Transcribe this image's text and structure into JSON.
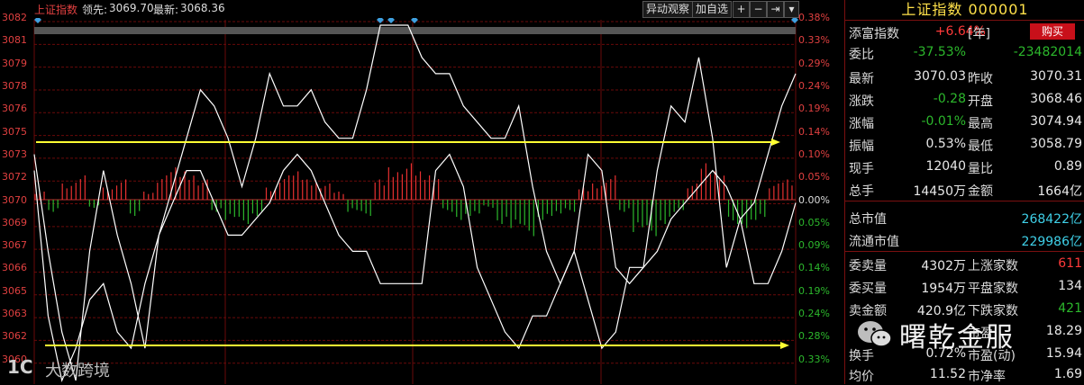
{
  "toolbar": {
    "index_name": "上证指数",
    "lead_label": "领先:",
    "lead_value": "3069.70",
    "latest_label": "最新:",
    "latest_value": "3068.36",
    "btn_watch": "异动观察",
    "btn_add": "加自选",
    "btn_plus": "+",
    "btn_minus": "−",
    "btn_end": "⇥",
    "btn_menu": "▾"
  },
  "axis_left": [
    "3082",
    "3081",
    "3079",
    "3078",
    "3076",
    "3075",
    "3073",
    "3072",
    "3070",
    "3069",
    "3067",
    "3066",
    "3065",
    "3063",
    "3062",
    "3060"
  ],
  "axis_right": [
    "0.38%",
    "0.33%",
    "0.29%",
    "0.24%",
    "0.19%",
    "0.14%",
    "0.10%",
    "0.05%",
    "0.00%",
    "0.05%",
    "0.09%",
    "0.14%",
    "0.19%",
    "0.24%",
    "0.28%",
    "0.33%"
  ],
  "colors": {
    "up": "#e83030",
    "down": "#2cb82c",
    "price_line": "#ffffff",
    "arrow": "#ffff33",
    "grid": "#6a0a0a",
    "title": "#ffe14a",
    "cyan": "#3fd0e8"
  },
  "watermark": {
    "left_text": "大数跨境",
    "right_text": "曙乾金服"
  },
  "panel": {
    "title": "上证指数 000001",
    "buy_label": "购买",
    "rows": [
      {
        "l1": "添富指数",
        "v1": "+6.64%",
        "l2": "[年]",
        "v2": ""
      },
      {
        "l1": "委比",
        "v1": "-37.53%",
        "l2": "",
        "v2": "-23482014"
      },
      {
        "l1": "最新",
        "v1": "3070.03",
        "l2": "昨收",
        "v2": "3070.31"
      },
      {
        "l1": "涨跌",
        "v1": "-0.28",
        "l2": "开盘",
        "v2": "3068.46"
      },
      {
        "l1": "涨幅",
        "v1": "-0.01%",
        "l2": "最高",
        "v2": "3074.94"
      },
      {
        "l1": "振幅",
        "v1": "0.53%",
        "l2": "最低",
        "v2": "3058.79"
      },
      {
        "l1": "现手",
        "v1": "12040",
        "l2": "量比",
        "v2": "0.89"
      },
      {
        "l1": "总手",
        "v1": "14450万",
        "l2": "金额",
        "v2": "1664亿"
      },
      {
        "l1": "总市值",
        "v1": "",
        "l2": "",
        "v2": "268422亿"
      },
      {
        "l1": "流通市值",
        "v1": "",
        "l2": "",
        "v2": "229986亿"
      },
      {
        "l1": "委卖量",
        "v1": "4302万",
        "l2": "上涨家数",
        "v2": "611"
      },
      {
        "l1": "委买量",
        "v1": "1954万",
        "l2": "平盘家数",
        "v2": "134"
      },
      {
        "l1": "卖金额",
        "v1": "420.9亿",
        "l2": "下跌家数",
        "v2": "421"
      },
      {
        "l1": "",
        "v1": "",
        "l2": "市盈",
        "v2": "18.29"
      },
      {
        "l1": "换手",
        "v1": "0.72%",
        "l2": "市盈(动)",
        "v2": "15.94"
      },
      {
        "l1": "均价",
        "v1": "11.52",
        "l2": "市净率",
        "v2": "1.69"
      }
    ]
  },
  "chart_data": {
    "type": "line",
    "title": "上证指数",
    "ylim": [
      3060,
      3082
    ],
    "y_right_percent_range": [
      -0.33,
      0.38
    ],
    "grid": true,
    "series": [
      {
        "values": [
          3074,
          3068,
          3063,
          3060,
          3068,
          3073,
          3069,
          3066,
          3062,
          3069,
          3072,
          3075,
          3078,
          3077,
          3075,
          3072,
          3075,
          3079,
          3077,
          3077,
          3078,
          3076,
          3075,
          3075,
          3078,
          3082,
          3082,
          3082,
          3080,
          3079,
          3079,
          3077,
          3076,
          3075,
          3075,
          3077,
          3072,
          3068,
          3066,
          3068,
          3065,
          3062,
          3063,
          3067,
          3067,
          3073,
          3077,
          3076,
          3080,
          3075,
          3067,
          3070,
          3071,
          3074,
          3077,
          3079
        ]
      },
      {
        "values": [
          3073,
          3064,
          3060,
          3062,
          3065,
          3066,
          3063,
          3062,
          3066,
          3069,
          3071,
          3073,
          3073,
          3071,
          3069,
          3069,
          3070,
          3071,
          3073,
          3074,
          3073,
          3071,
          3069,
          3068,
          3068,
          3066,
          3066,
          3066,
          3066,
          3073,
          3074,
          3072,
          3067,
          3065,
          3063,
          3062,
          3064,
          3064,
          3066,
          3068,
          3074,
          3073,
          3067,
          3066,
          3067,
          3068,
          3070,
          3071,
          3072,
          3073,
          3072,
          3070,
          3066,
          3066,
          3068,
          3071
        ]
      }
    ],
    "volume_bars": [
      0.2,
      -0.3,
      0.4,
      0.6,
      -0.2,
      0.3,
      0.5,
      -0.4,
      0.2,
      0.6,
      0.8,
      0.7,
      0.5,
      -0.3,
      -0.5,
      -0.6,
      -0.4,
      0.3,
      0.6,
      0.7,
      0.5,
      0.4,
      0.2,
      -0.3,
      -0.4,
      0.5,
      0.8,
      0.9,
      0.7,
      0.6,
      -0.3,
      -0.5,
      -0.4,
      -0.2,
      -0.6,
      -0.7,
      -0.9,
      -0.5,
      -0.4,
      -0.3,
      0.3,
      0.4,
      0.6,
      -0.3,
      -0.8,
      -0.9,
      -0.6,
      -0.3,
      0.4,
      0.9,
      0.7,
      -0.6,
      -0.7,
      -0.5,
      0.4,
      0.5
    ]
  }
}
